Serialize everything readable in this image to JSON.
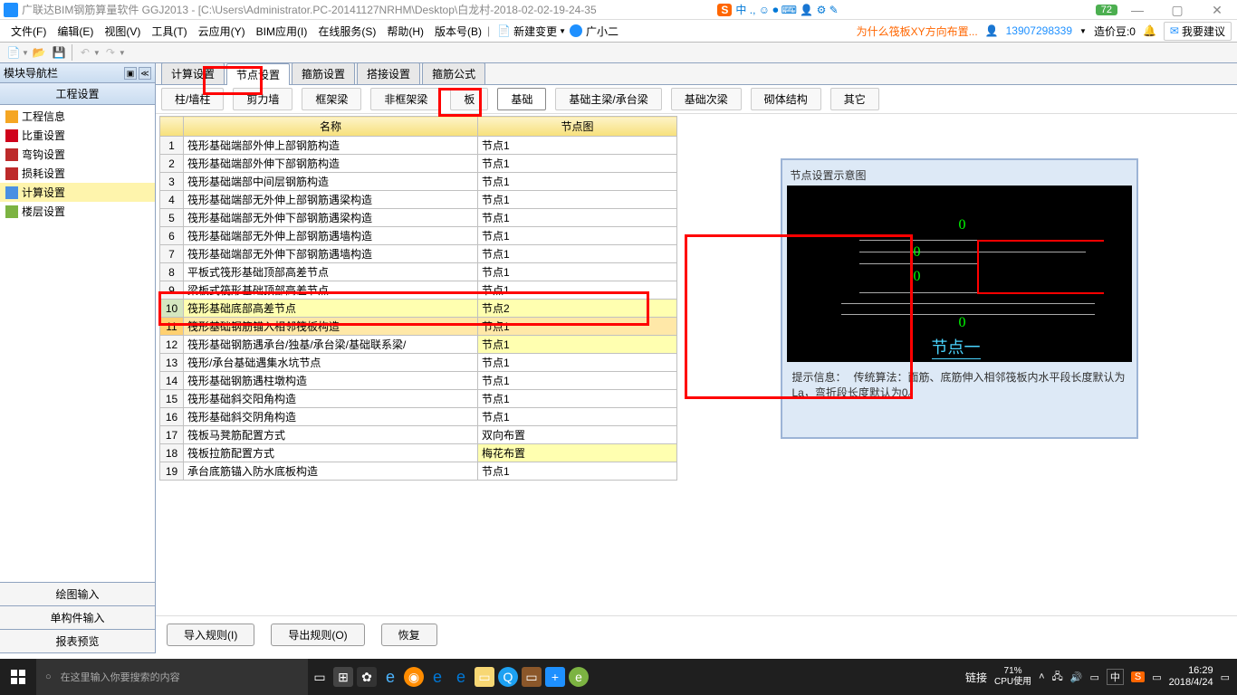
{
  "title_bar": {
    "title": "广联达BIM钢筋算量软件 GGJ2013 - [C:\\Users\\Administrator.PC-20141127NRHM\\Desktop\\白龙村-2018-02-02-19-24-35",
    "ime": "S",
    "ime_extra": "中 ., ☺ ⏺ ⌨ 👤 ⚙ ✎",
    "score": "72"
  },
  "menu": {
    "items": [
      "文件(F)",
      "编辑(E)",
      "视图(V)",
      "工具(T)",
      "云应用(Y)",
      "BIM应用(I)",
      "在线服务(S)",
      "帮助(H)",
      "版本号(B)"
    ],
    "new_change": "新建变更",
    "user_small": "广小二",
    "warning": "为什么筏板XY方向布置...",
    "phone": "13907298339",
    "price_label": "造价豆:0",
    "suggest": "我要建议"
  },
  "left_panel": {
    "nav_title": "模块导航栏",
    "sub_title": "工程设置",
    "items": [
      {
        "label": "工程信息",
        "icon": "icon-yellow"
      },
      {
        "label": "比重设置",
        "icon": "icon-red"
      },
      {
        "label": "弯钩设置",
        "icon": "icon-red2"
      },
      {
        "label": "损耗设置",
        "icon": "icon-red2"
      },
      {
        "label": "计算设置",
        "icon": "icon-blue",
        "selected": true
      },
      {
        "label": "楼层设置",
        "icon": "icon-green"
      }
    ],
    "bottom_buttons": [
      "绘图输入",
      "单构件输入",
      "报表预览"
    ]
  },
  "sheet_tabs": [
    "计算设置",
    "节点设置",
    "箍筋设置",
    "搭接设置",
    "箍筋公式"
  ],
  "sheet_active": 1,
  "comp_tabs": [
    "柱/墙柱",
    "剪力墙",
    "框架梁",
    "非框架梁",
    "板",
    "基础",
    "基础主梁/承台梁",
    "基础次梁",
    "砌体结构",
    "其它"
  ],
  "comp_active": 5,
  "table": {
    "headers": [
      "名称",
      "节点图"
    ],
    "rows": [
      {
        "idx": "1",
        "name": "筏形基础端部外伸上部钢筋构造",
        "val": "节点1"
      },
      {
        "idx": "2",
        "name": "筏形基础端部外伸下部钢筋构造",
        "val": "节点1"
      },
      {
        "idx": "3",
        "name": "筏形基础端部中间层钢筋构造",
        "val": "节点1"
      },
      {
        "idx": "4",
        "name": "筏形基础端部无外伸上部钢筋遇梁构造",
        "val": "节点1"
      },
      {
        "idx": "5",
        "name": "筏形基础端部无外伸下部钢筋遇梁构造",
        "val": "节点1"
      },
      {
        "idx": "6",
        "name": "筏形基础端部无外伸上部钢筋遇墙构造",
        "val": "节点1"
      },
      {
        "idx": "7",
        "name": "筏形基础端部无外伸下部钢筋遇墙构造",
        "val": "节点1"
      },
      {
        "idx": "8",
        "name": "平板式筏形基础顶部高差节点",
        "val": "节点1"
      },
      {
        "idx": "9",
        "name": "梁板式筏形基础顶部高差节点",
        "val": "节点1"
      },
      {
        "idx": "10",
        "name": "筏形基础底部高差节点",
        "val": "节点2",
        "yellow": true
      },
      {
        "idx": "11",
        "name": "筏形基础钢筋锚入相邻筏板构造",
        "val": "节点1",
        "selected": true
      },
      {
        "idx": "12",
        "name": "筏形基础钢筋遇承台/独基/承台梁/基础联系梁/",
        "val": "节点1",
        "val_yellow": true
      },
      {
        "idx": "13",
        "name": "筏形/承台基础遇集水坑节点",
        "val": "节点1"
      },
      {
        "idx": "14",
        "name": "筏形基础钢筋遇柱墩构造",
        "val": "节点1"
      },
      {
        "idx": "15",
        "name": "筏形基础斜交阳角构造",
        "val": "节点1"
      },
      {
        "idx": "16",
        "name": "筏形基础斜交阴角构造",
        "val": "节点1"
      },
      {
        "idx": "17",
        "name": "筏板马凳筋配置方式",
        "val": "双向布置"
      },
      {
        "idx": "18",
        "name": "筏板拉筋配置方式",
        "val": "梅花布置",
        "val_yellow": true
      },
      {
        "idx": "19",
        "name": "承台底筋锚入防水底板构造",
        "val": "节点1"
      }
    ]
  },
  "diagram": {
    "title": "节点设置示意图",
    "node_label": "节点一",
    "hint_prefix": "提示信息：",
    "hint_text": "传统算法：面筋、底筋伸入相邻筏板内水平段长度默认为La，弯折段长度默认为0。"
  },
  "bottom_buttons": {
    "import": "导入规则(I)",
    "export": "导出规则(O)",
    "restore": "恢复"
  },
  "taskbar": {
    "search_placeholder": "在这里输入你要搜索的内容",
    "link": "链接",
    "cpu_pct": "71%",
    "cpu_label": "CPU使用",
    "time": "16:29",
    "date": "2018/4/24",
    "ime_badge": "中"
  }
}
